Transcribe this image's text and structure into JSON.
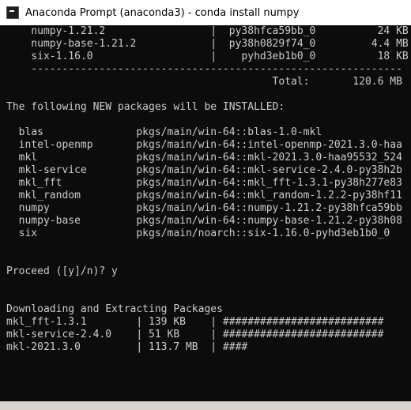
{
  "window": {
    "title": "Anaconda Prompt (anaconda3) - conda  install numpy"
  },
  "console_lines": [
    "    numpy-1.21.2                 |  py38hfca59bb_0          24 KB",
    "    numpy-base-1.21.2            |  py38h0829f74_0         4.4 MB",
    "    six-1.16.0                   |    pyhd3eb1b0_0          18 KB",
    "    ------------------------------------------------------------",
    "                                           Total:       120.6 MB",
    "",
    "The following NEW packages will be INSTALLED:",
    "",
    "  blas               pkgs/main/win-64::blas-1.0-mkl",
    "  intel-openmp       pkgs/main/win-64::intel-openmp-2021.3.0-haa",
    "  mkl                pkgs/main/win-64::mkl-2021.3.0-haa95532_524",
    "  mkl-service        pkgs/main/win-64::mkl-service-2.4.0-py38h2b",
    "  mkl_fft            pkgs/main/win-64::mkl_fft-1.3.1-py38h277e83",
    "  mkl_random         pkgs/main/win-64::mkl_random-1.2.2-py38hf11",
    "  numpy              pkgs/main/win-64::numpy-1.21.2-py38hfca59bb",
    "  numpy-base         pkgs/main/win-64::numpy-base-1.21.2-py38h08",
    "  six                pkgs/main/noarch::six-1.16.0-pyhd3eb1b0_0",
    "",
    "",
    "Proceed ([y]/n)? y",
    "",
    "",
    "Downloading and Extracting Packages",
    "mkl_fft-1.3.1        | 139 KB    | ##########################",
    "mkl-service-2.4.0    | 51 KB     | ##########################",
    "mkl-2021.3.0         | 113.7 MB  | ####"
  ]
}
